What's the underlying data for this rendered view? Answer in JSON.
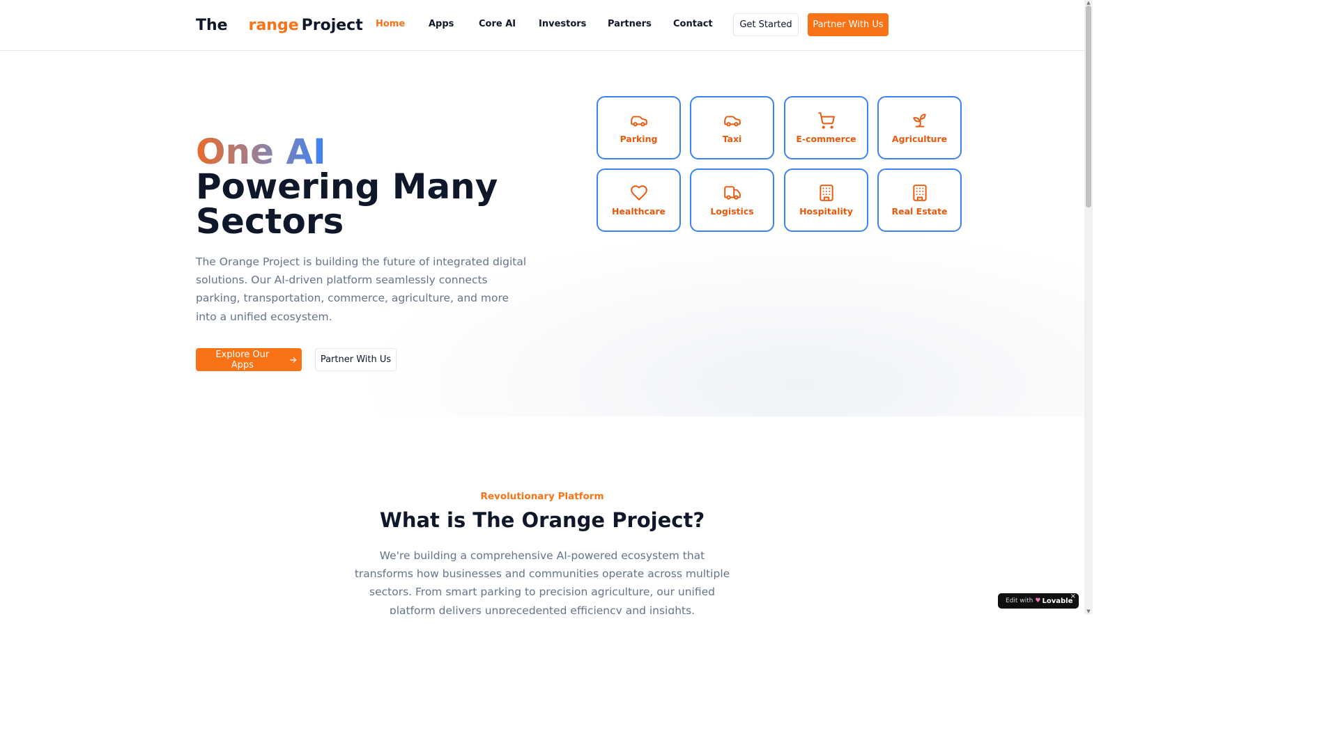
{
  "header": {
    "logo": {
      "part1": "The",
      "part2": "range",
      "part3": "Project"
    },
    "nav": [
      {
        "label": "Home",
        "active": true
      },
      {
        "label": "Apps",
        "active": false
      },
      {
        "label": "Core AI",
        "active": false
      },
      {
        "label": "Investors",
        "active": false
      },
      {
        "label": "Partners",
        "active": false
      },
      {
        "label": "Contact",
        "active": false
      }
    ],
    "get_started_label": "Get Started",
    "partner_label": "Partner With Us"
  },
  "hero": {
    "title_highlight": "One AI",
    "title_line2": "Powering Many",
    "title_line3": "Sectors",
    "description": "The Orange Project is building the future of integrated digital solutions. Our AI-driven platform seamlessly connects parking, transportation, commerce, agriculture, and more into a unified ecosystem.",
    "explore_label": "Explore Our Apps",
    "partner_label": "Partner With Us"
  },
  "sectors": [
    {
      "label": "Parking",
      "icon": "car-icon"
    },
    {
      "label": "Taxi",
      "icon": "car-icon"
    },
    {
      "label": "E-commerce",
      "icon": "shopping-cart-icon"
    },
    {
      "label": "Agriculture",
      "icon": "sprout-icon"
    },
    {
      "label": "Healthcare",
      "icon": "heart-icon"
    },
    {
      "label": "Logistics",
      "icon": "truck-icon"
    },
    {
      "label": "Hospitality",
      "icon": "building-icon"
    },
    {
      "label": "Real Estate",
      "icon": "building-icon"
    }
  ],
  "about": {
    "eyebrow": "Revolutionary Platform",
    "title": "What is The Orange Project?",
    "description": "We're building a comprehensive AI-powered ecosystem that transforms how businesses and communities operate across multiple sectors. From smart parking to precision agriculture, our unified platform delivers unprecedented efficiency and insights."
  },
  "badge": {
    "edit": "Edit with",
    "brand": "Lovable",
    "close": "×"
  },
  "colors": {
    "accent": "#f97316",
    "sector_border": "#3b82f6",
    "text_dark": "#0f172a",
    "text_muted": "#64748b"
  }
}
